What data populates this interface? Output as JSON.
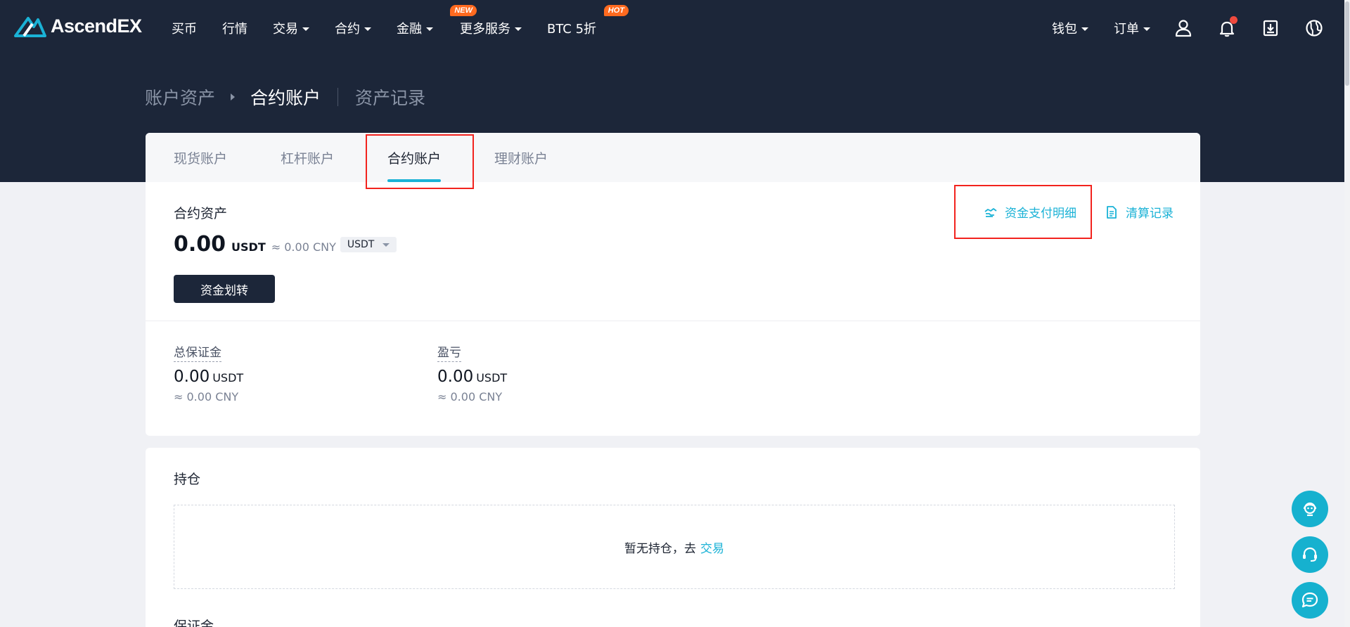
{
  "brand": {
    "name": "AscendEX"
  },
  "nav": {
    "items": [
      {
        "label": "买币",
        "dropdown": false
      },
      {
        "label": "行情",
        "dropdown": false
      },
      {
        "label": "交易",
        "dropdown": true
      },
      {
        "label": "合约",
        "dropdown": true
      },
      {
        "label": "金融",
        "dropdown": true,
        "badge": "NEW"
      },
      {
        "label": "更多服务",
        "dropdown": true
      },
      {
        "label": "BTC 5折",
        "dropdown": false,
        "badge": "HOT"
      }
    ],
    "right": {
      "wallet": "钱包",
      "orders": "订单"
    }
  },
  "breadcrumb": {
    "root": "账户资产",
    "current": "合约账户",
    "history": "资产记录"
  },
  "tabs": [
    "现货账户",
    "杠杆账户",
    "合约账户",
    "理财账户"
  ],
  "active_tab": "合约账户",
  "asset": {
    "title": "合约资产",
    "value": "0.00",
    "unit": "USDT",
    "approx": "≈ 0.00 CNY",
    "currency": "USDT",
    "transfer_button": "资金划转",
    "link_funding": "资金支付明细",
    "link_settlement": "清算记录"
  },
  "stats": [
    {
      "label": "总保证金",
      "value": "0.00",
      "unit": "USDT",
      "approx": "≈ 0.00 CNY"
    },
    {
      "label": "盈亏",
      "value": "0.00",
      "unit": "USDT",
      "approx": "≈ 0.00 CNY"
    }
  ],
  "positions": {
    "title": "持仓",
    "empty_text": "暂无持仓，去",
    "trade_link": "交易"
  },
  "margin": {
    "title": "保证金"
  },
  "colors": {
    "header_bg": "#1c2639",
    "accent": "#1ab2d6",
    "highlight": "#f2231e",
    "badge": "#ff6a1f"
  }
}
